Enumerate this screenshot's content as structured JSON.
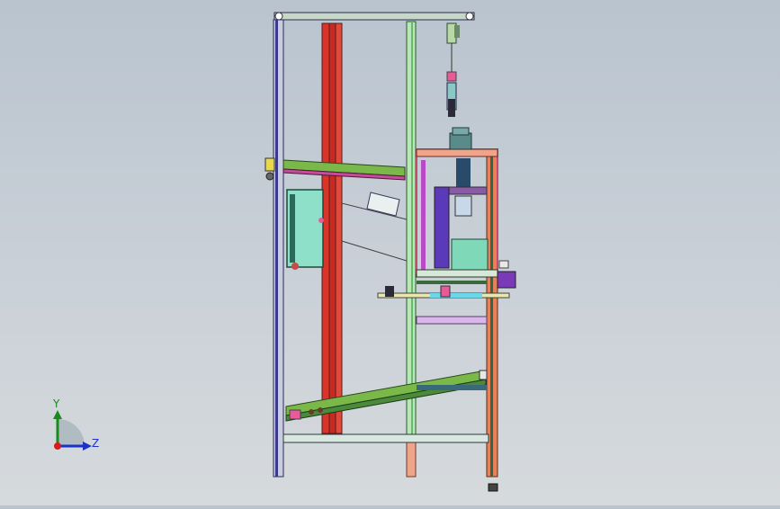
{
  "viewport": {
    "background_top": "#b9c4cf",
    "background_bottom": "#d6dadd"
  },
  "model": {
    "frame_color": "#3a3a8a",
    "column_red": "#d8352a",
    "column_green": "#7fd18a",
    "column_salmon": "#f0a58a",
    "conveyor_green": "#7ab84a",
    "hopper_color": "#8fe0c8",
    "motor_color": "#6a8a8a",
    "bracket_purple": "#5a3ab8",
    "accent_cyan": "#6ad8e8",
    "accent_pink": "#e85a9a"
  },
  "triad": {
    "y_label": "Y",
    "z_label": "Z",
    "y_color": "#1a8a1a",
    "z_color": "#1a32c8",
    "origin_color": "#d81a1a"
  }
}
